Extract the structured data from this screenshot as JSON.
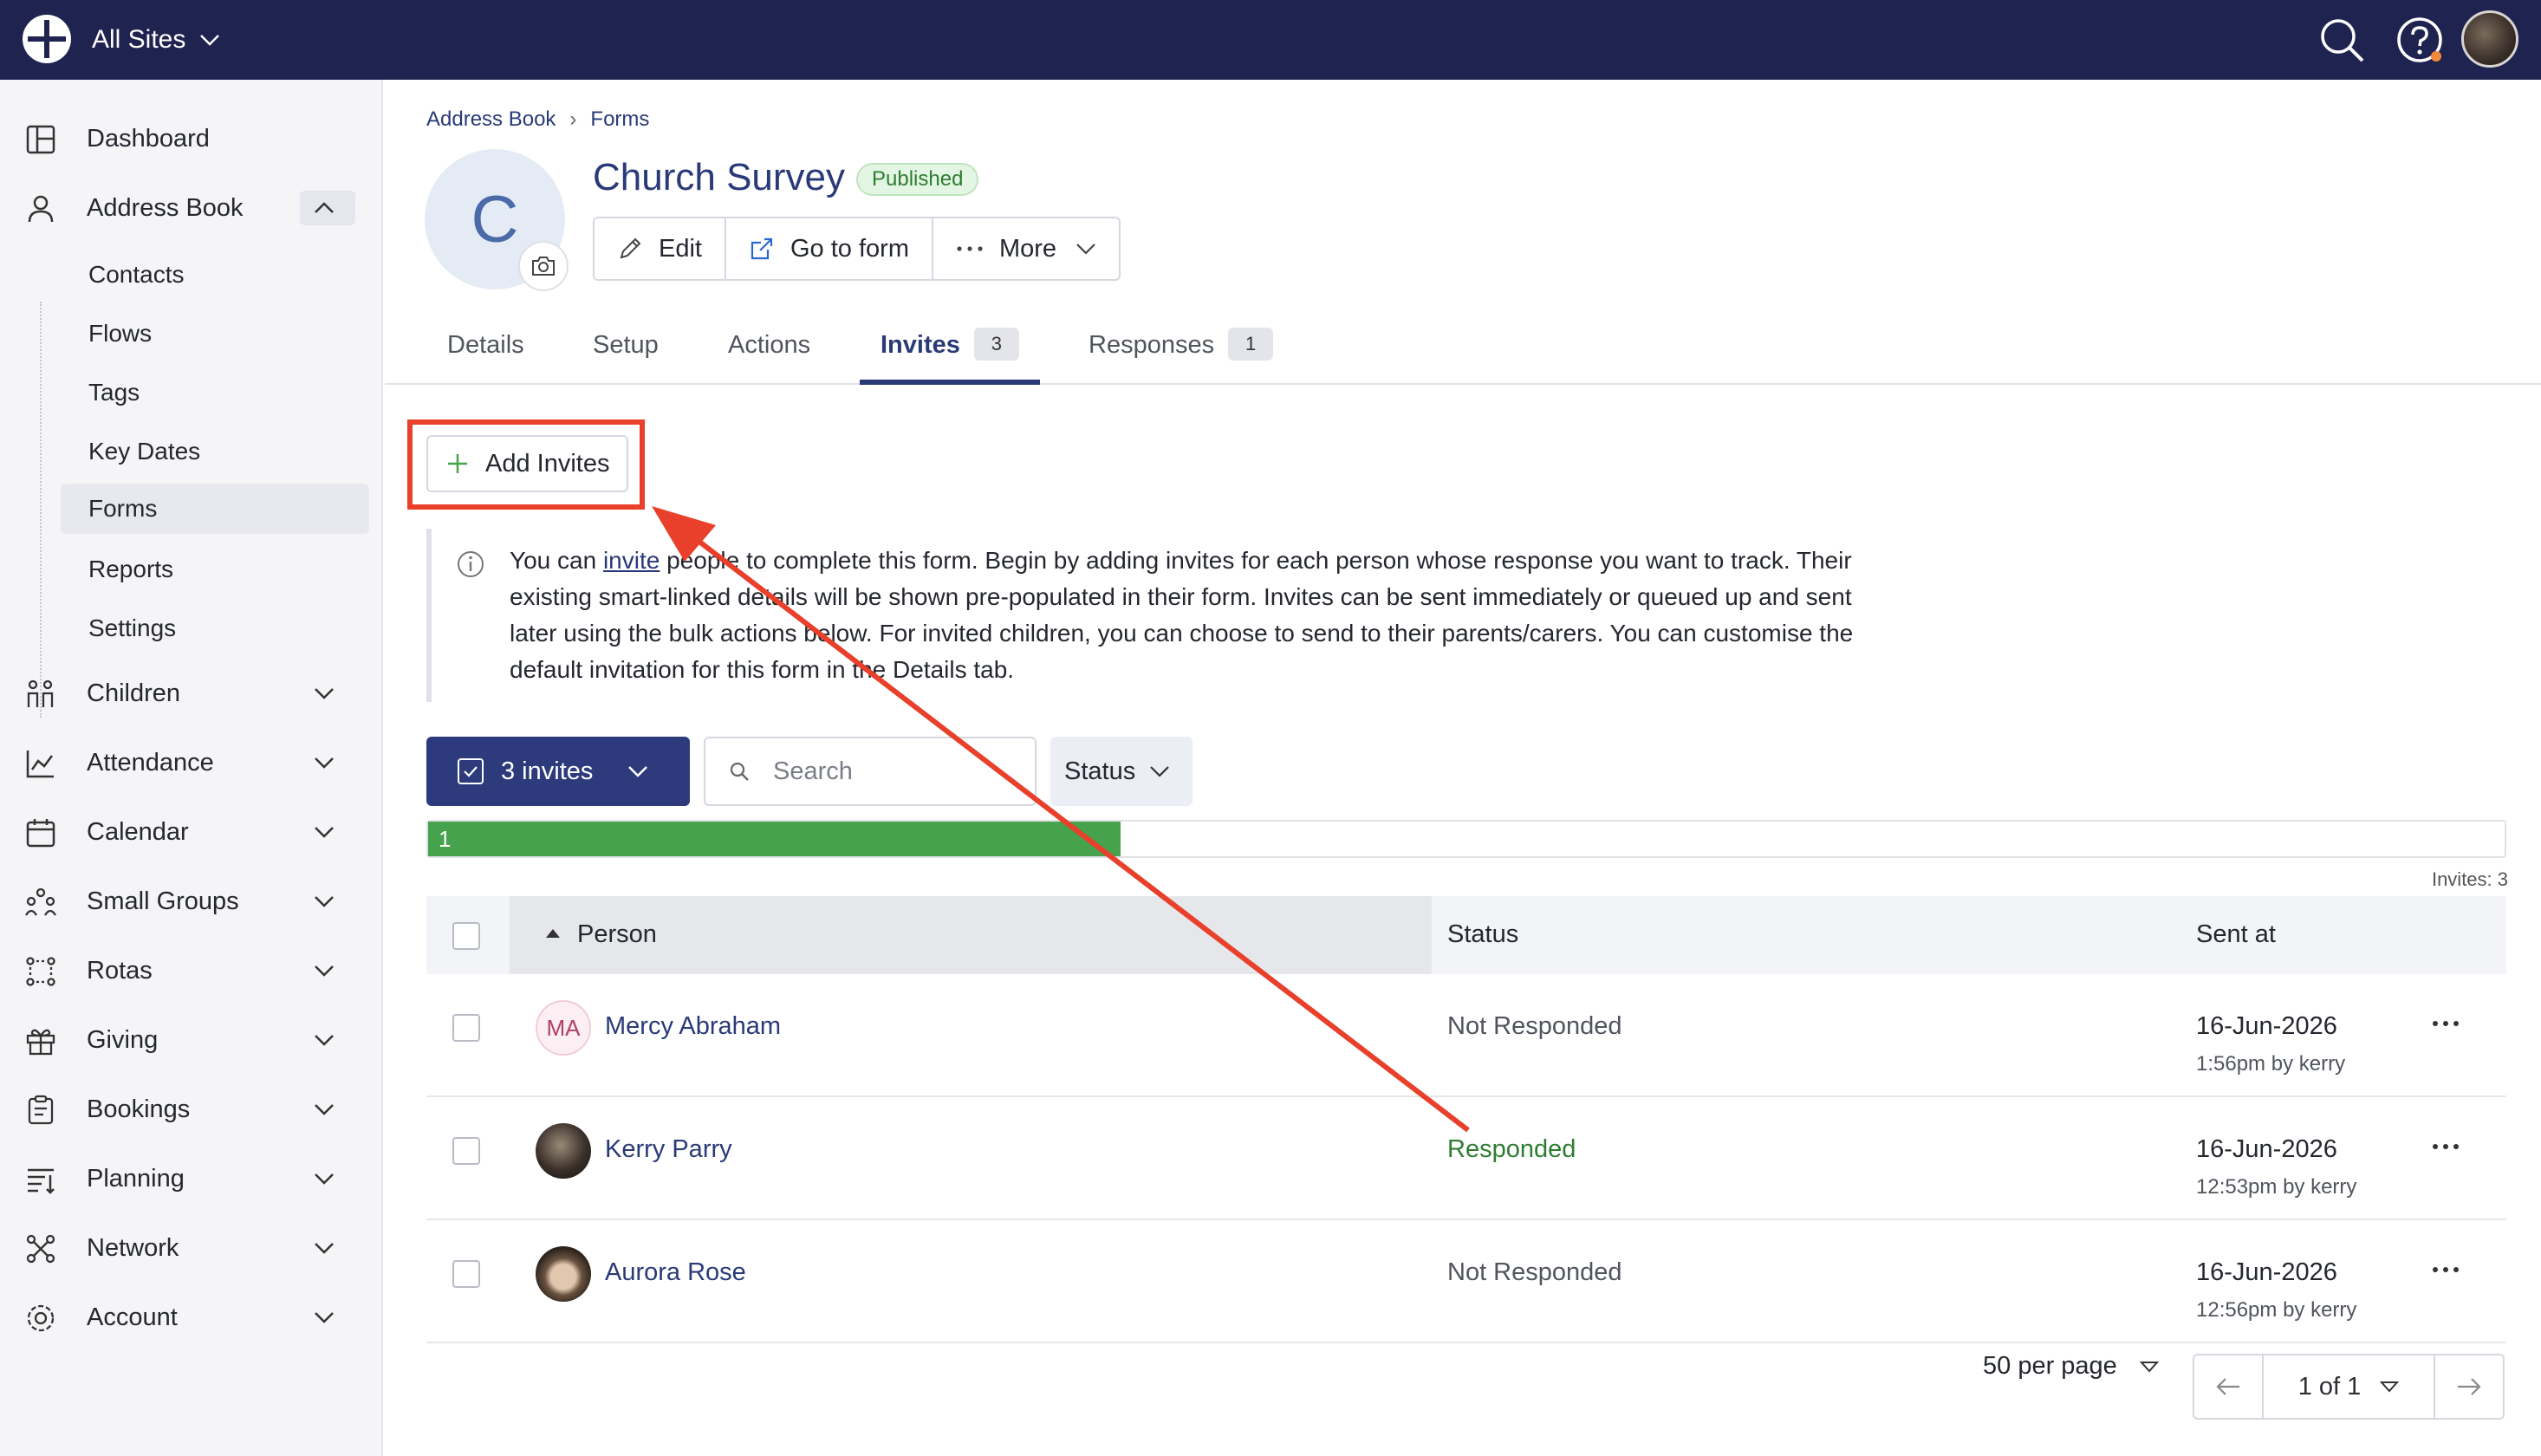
{
  "topbar": {
    "site_label": "All Sites"
  },
  "sidebar": {
    "items": [
      {
        "label": "Dashboard",
        "icon": "dashboard-icon"
      },
      {
        "label": "Address Book",
        "icon": "person-icon"
      },
      {
        "label": "Children",
        "icon": "children-icon"
      },
      {
        "label": "Attendance",
        "icon": "attendance-chart-icon"
      },
      {
        "label": "Calendar",
        "icon": "calendar-icon"
      },
      {
        "label": "Small Groups",
        "icon": "small-groups-icon"
      },
      {
        "label": "Rotas",
        "icon": "rotas-icon"
      },
      {
        "label": "Giving",
        "icon": "gift-icon"
      },
      {
        "label": "Bookings",
        "icon": "bookings-icon"
      },
      {
        "label": "Planning",
        "icon": "planning-icon"
      },
      {
        "label": "Network",
        "icon": "network-icon"
      },
      {
        "label": "Account",
        "icon": "gear-icon"
      }
    ],
    "sub_items": [
      "Contacts",
      "Flows",
      "Tags",
      "Key Dates",
      "Forms",
      "Reports",
      "Settings"
    ],
    "active_sub_item": "Forms"
  },
  "breadcrumb": [
    "Address Book",
    "Forms"
  ],
  "form": {
    "avatar_letter": "C",
    "title": "Church Survey",
    "status_badge": "Published",
    "actions": {
      "edit": "Edit",
      "go_to_form": "Go to form",
      "more": "More"
    }
  },
  "tabs": [
    {
      "label": "Details"
    },
    {
      "label": "Setup"
    },
    {
      "label": "Actions"
    },
    {
      "label": "Invites",
      "count": "3"
    },
    {
      "label": "Responses",
      "count": "1"
    }
  ],
  "add_invites_label": "Add Invites",
  "info": {
    "prefix": "You can ",
    "link": "invite",
    "suffix": " people to complete this form. Begin by adding invites for each person whose response you want to track. Their existing smart-linked details will be shown pre-populated in their form. Invites can be sent immediately or queued up and sent later using the bulk actions below. For invited children, you can choose to send to their parents/carers. You can customise the default invitation for this form in the Details tab."
  },
  "toolbar": {
    "invites_button": "3 invites",
    "search_placeholder": "Search",
    "status_filter": "Status"
  },
  "progress": {
    "label": "1",
    "responded": 1,
    "total": 3
  },
  "invites_count": "Invites: 3",
  "table": {
    "headers": {
      "person": "Person",
      "status": "Status",
      "sent_at": "Sent at"
    },
    "rows": [
      {
        "initials": "MA",
        "name": "Mercy Abraham",
        "status": "Not Responded",
        "date": "16-Jun-2026",
        "by": "1:56pm by kerry"
      },
      {
        "initials": "",
        "name": "Kerry Parry",
        "status": "Responded",
        "date": "16-Jun-2026",
        "by": "12:53pm by kerry"
      },
      {
        "initials": "",
        "name": "Aurora Rose",
        "status": "Not Responded",
        "date": "16-Jun-2026",
        "by": "12:56pm by kerry"
      }
    ]
  },
  "pagination": {
    "per_page": "50 per page",
    "page": "1 of 1"
  },
  "colors": {
    "topbar": "#1f2350",
    "primary": "#2d3a7c",
    "success": "#46a24c",
    "annotation": "#e8402a"
  }
}
